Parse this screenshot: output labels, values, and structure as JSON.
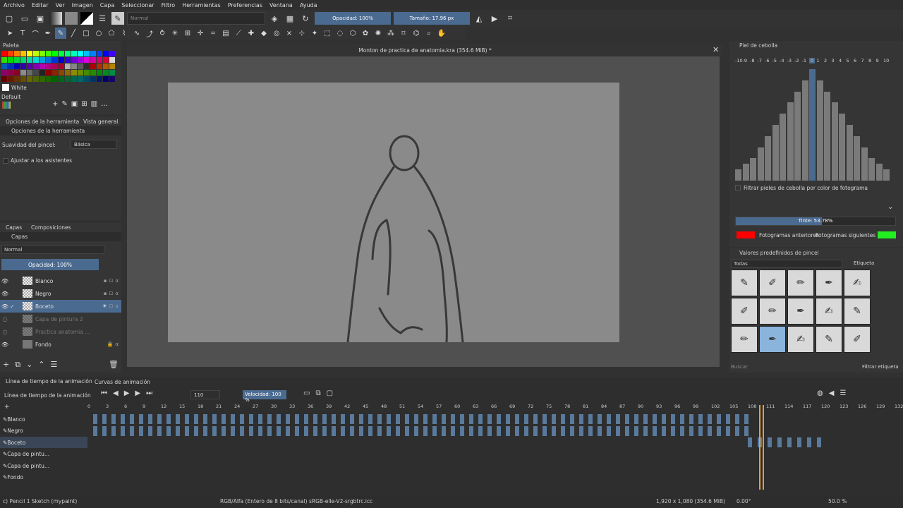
{
  "menu": [
    "Archivo",
    "Editar",
    "Ver",
    "Imagen",
    "Capa",
    "Seleccionar",
    "Filtro",
    "Herramientas",
    "Preferencias",
    "Ventana",
    "Ayuda"
  ],
  "toolbar": {
    "blend_mode": "Normal",
    "opacity": "Opacidad: 100%",
    "size": "Tamaño: 17.96 px"
  },
  "palette": {
    "title": "Paleta",
    "selected_color_name": "White",
    "palette_name": "Default",
    "colors": [
      "#ff0000",
      "#ff4000",
      "#ff8000",
      "#ffbf00",
      "#ffff00",
      "#bfff00",
      "#80ff00",
      "#40ff00",
      "#00ff00",
      "#00ff40",
      "#00ff80",
      "#00ffbf",
      "#00ffff",
      "#00bfff",
      "#0080ff",
      "#0040ff",
      "#0000ff",
      "#4000ff",
      "#8000ff",
      "#bf00ff",
      "#ff00ff",
      "#ff00bf",
      "#ff0080",
      "#ff0040",
      "#ffffff",
      "#c0c0c0",
      "#808080",
      "#404040"
    ]
  },
  "tool_options": {
    "tabs": [
      "Opciones de la herramienta",
      "Vista general"
    ],
    "title": "Opciones de la herramienta",
    "smoothing_label": "Suavidad del pincel:",
    "smoothing_value": "Básica",
    "assistants_label": "Ajustar a los asistentes"
  },
  "layers_panel": {
    "tabs": [
      "Capas",
      "Composiciones"
    ],
    "title": "Capas",
    "blend_mode": "Normal",
    "opacity": "Opacidad:  100%",
    "layers": [
      {
        "name": "Blanco"
      },
      {
        "name": "Negro"
      },
      {
        "name": "Boceto"
      },
      {
        "name": "Capa de pintura 2"
      },
      {
        "name": "Practica anatomia ..."
      },
      {
        "name": "Fondo"
      }
    ]
  },
  "document": {
    "title": "Monton de practica de anatomia.kra (354.6 MiB) *"
  },
  "onion_skin": {
    "title": "Piel de cebolla",
    "numbers": [
      "-10",
      "-9",
      "-8",
      "-7",
      "-6",
      "-5",
      "-4",
      "-3",
      "-2",
      "-1",
      "0",
      "1",
      "2",
      "3",
      "4",
      "5",
      "6",
      "7",
      "8",
      "9",
      "10"
    ],
    "levels": [
      0.1,
      0.15,
      0.2,
      0.3,
      0.4,
      0.5,
      0.6,
      0.7,
      0.8,
      0.9,
      1.0,
      0.9,
      0.8,
      0.7,
      0.6,
      0.5,
      0.4,
      0.3,
      0.2,
      0.15,
      0.1
    ],
    "filter_label": "Filtrar pieles de cebolla por color de fotograma",
    "tint": "Tinte: 53.78%",
    "tint_fraction": 0.5378,
    "prev_label": "Fotogramas anteriores",
    "next_label": "Fotogramas siguientes",
    "prev_color": "#ff0000",
    "next_color": "#22ee22"
  },
  "brush_presets": {
    "title": "Valores predefinidos de pincel",
    "filter": "Todas",
    "tag_label": "Etiqueta",
    "search_placeholder": "Buscar",
    "filter_tag_label": "Filtrar etiqueta"
  },
  "timeline": {
    "tabs": [
      "Línea de tiempo de la animación",
      "Curvas de animación"
    ],
    "title": "Línea de tiempo de la animación",
    "current_frame": "110",
    "speed": "Velocidad: 100 %",
    "ruler": [
      "0",
      "3",
      "6",
      "9",
      "12",
      "15",
      "18",
      "21",
      "24",
      "27",
      "30",
      "33",
      "36",
      "39",
      "42",
      "45",
      "48",
      "51",
      "54",
      "57",
      "60",
      "63",
      "66",
      "69",
      "72",
      "75",
      "78",
      "81",
      "84",
      "87",
      "90",
      "93",
      "96",
      "99",
      "102",
      "105",
      "108",
      "111",
      "114",
      "117",
      "120",
      "123",
      "126",
      "129",
      "132"
    ],
    "layers": [
      "Blanco",
      "Negro",
      "Boceto",
      "Capa de pintu...",
      "Capa de pintu...",
      "Fondo"
    ]
  },
  "statusbar": {
    "brush": "c) Pencil 1 Sketch (mypaint)",
    "color_model": "RGB/Alfa (Entero de 8 bits/canal)  sRGB-elle-V2-srgbtrc.icc",
    "dimensions": "1,920 x 1,080 (354.6 MiB)",
    "rotation": "0.00°",
    "zoom": "50.0 %"
  }
}
